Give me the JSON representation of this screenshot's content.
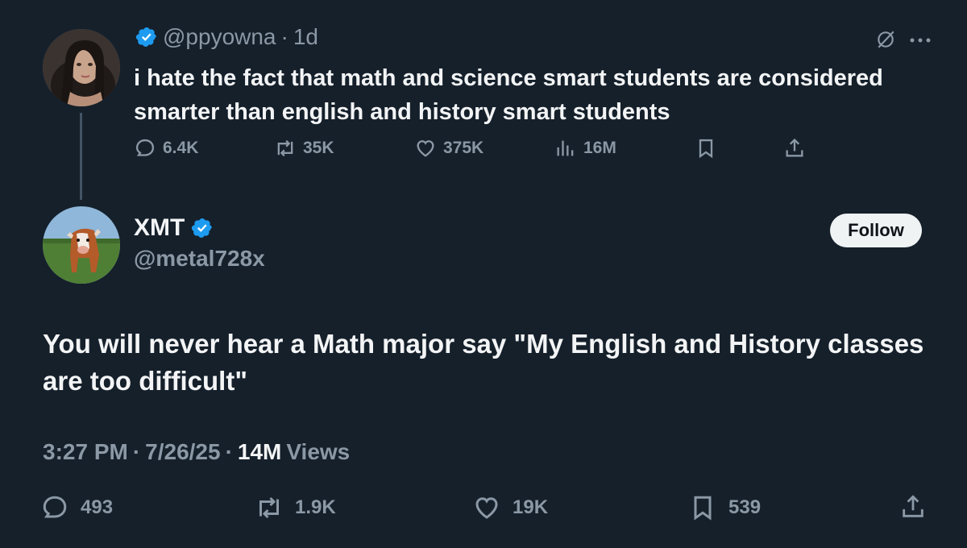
{
  "original_tweet": {
    "handle": "@ppyowna",
    "separator": "·",
    "age": "1d",
    "text": "i hate the fact that math and science smart students are considered smarter than english and history smart students",
    "stats": {
      "replies": "6.4K",
      "retweets": "35K",
      "likes": "375K",
      "views": "16M"
    }
  },
  "reply_tweet": {
    "display_name": "XMT",
    "handle": "@metal728x",
    "follow_label": "Follow",
    "text": "You will never hear a Math major say \"My English and History classes are too difficult\"",
    "time": "3:27 PM",
    "date": "7/26/25",
    "views_count": "14M",
    "views_label": "Views",
    "stats": {
      "replies": "493",
      "retweets": "1.9K",
      "likes": "19K",
      "bookmarks": "539"
    }
  },
  "colors": {
    "background": "#15202b",
    "primary_text": "#e7e9ea",
    "secondary_text": "#8b98a5",
    "verified": "#1d9bf0",
    "follow_button": "#eff3f4"
  }
}
